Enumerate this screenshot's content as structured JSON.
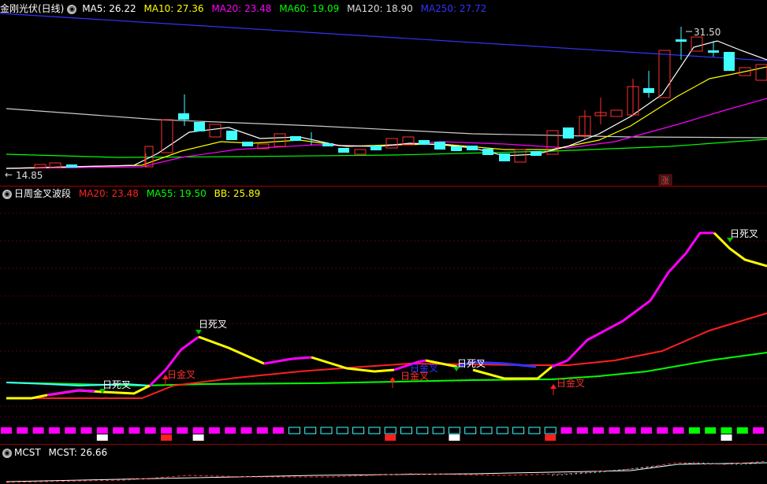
{
  "panel_main": {
    "title": "金刚光伏(日线)",
    "indicators": [
      {
        "label": "MA5: 26.22",
        "color": "#ffffff"
      },
      {
        "label": "MA10: 27.36",
        "color": "#ffff00"
      },
      {
        "label": "MA20: 23.48",
        "color": "#ff00ff"
      },
      {
        "label": "MA60: 19.09",
        "color": "#00ff00"
      },
      {
        "label": "MA120: 18.90",
        "color": "#dddddd"
      },
      {
        "label": "MA250: 27.72",
        "color": "#3333ff"
      }
    ],
    "high_label": "31.50",
    "low_label": "14.85",
    "zhang_badge": "涨"
  },
  "panel_mid": {
    "title": "日周金叉波段",
    "indicators": [
      {
        "label": "MA20: 23.48",
        "color": "#ff2020"
      },
      {
        "label": "MA55: 19.50",
        "color": "#00ff00"
      },
      {
        "label": "BB: 25.89",
        "color": "#ffff00"
      }
    ],
    "signals": [
      {
        "text": "日死叉",
        "kind": "death"
      },
      {
        "text": "日金叉",
        "kind": "golden"
      },
      {
        "text": "日死叉",
        "kind": "death"
      },
      {
        "text": "日金叉",
        "kind": "golden"
      },
      {
        "text": "日金叉",
        "kind": "golden"
      },
      {
        "text": "日死叉",
        "kind": "death"
      },
      {
        "text": "日金叉",
        "kind": "golden"
      },
      {
        "text": "日死叉",
        "kind": "death"
      }
    ]
  },
  "panel_bottom": {
    "title": "MCST",
    "indicators": [
      {
        "label": "MCST: 26.66",
        "color": "#ffffff"
      }
    ]
  },
  "colors": {
    "up_candle": "#ff3030",
    "down_candle": "#40ffff",
    "magenta": "#ff00ff",
    "yellow": "#ffff00",
    "blue": "#3333ff",
    "green": "#00ff00",
    "red": "#ff2020"
  }
}
